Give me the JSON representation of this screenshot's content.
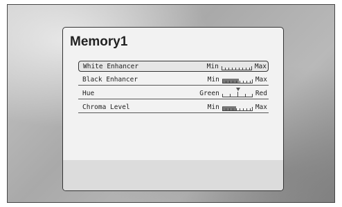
{
  "menu": {
    "title": "Memory1",
    "items": [
      {
        "label": "White Enhancer",
        "min_label": "Min",
        "max_label": "Max",
        "level": 0.0,
        "selected": true
      },
      {
        "label": "Black Enhancer",
        "min_label": "Min",
        "max_label": "Max",
        "level": 0.55,
        "selected": false
      },
      {
        "label": "Hue",
        "min_label": "Green",
        "max_label": "Red",
        "level": 0.5,
        "selected": false
      },
      {
        "label": "Chroma Level",
        "min_label": "Min",
        "max_label": "Max",
        "level": 0.45,
        "selected": false
      }
    ]
  }
}
